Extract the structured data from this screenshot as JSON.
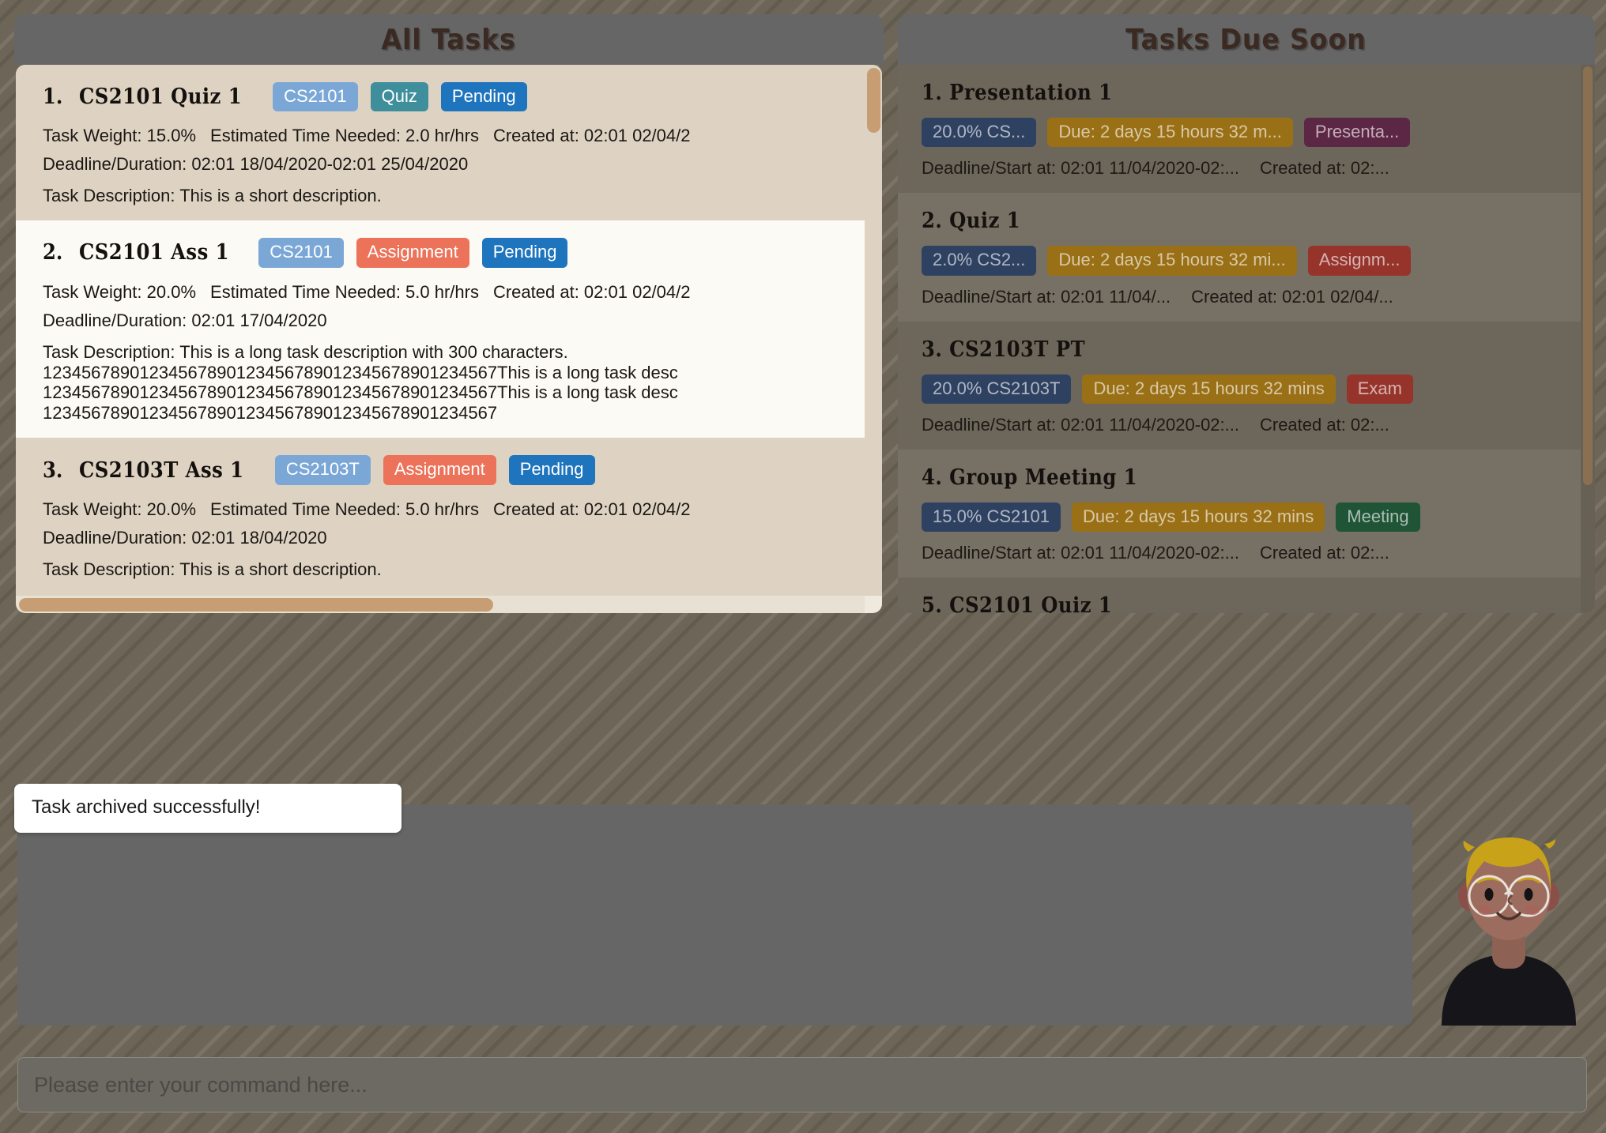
{
  "all_tasks": {
    "title": "All Tasks",
    "tasks": [
      {
        "index": "1.",
        "name": "CS2101 Quiz 1",
        "badges": [
          {
            "label": "CS2101",
            "color": "#7ba7d7"
          },
          {
            "label": "Quiz",
            "color": "#3f8e9b"
          },
          {
            "label": "Pending",
            "color": "#1f75bd"
          }
        ],
        "weight": "Task Weight: 15.0%",
        "est_time": "Estimated Time Needed: 2.0 hr/hrs",
        "created": "Created at: 02:01 02/04/2",
        "deadline": "Deadline/Duration: 02:01 18/04/2020-02:01 25/04/2020",
        "description": "Task Description: This is a short description."
      },
      {
        "index": "2.",
        "name": "CS2101 Ass 1",
        "badges": [
          {
            "label": "CS2101",
            "color": "#7ba7d7"
          },
          {
            "label": "Assignment",
            "color": "#ec7259"
          },
          {
            "label": "Pending",
            "color": "#1f75bd"
          }
        ],
        "weight": "Task Weight: 20.0%",
        "est_time": "Estimated Time Needed: 5.0 hr/hrs",
        "created": "Created at: 02:01 02/04/2",
        "deadline": "Deadline/Duration: 02:01 17/04/2020",
        "description": "Task Description: This is a long task description with 300 characters.\n12345678901234567890123456789012345678901234567This is a long task desc\n12345678901234567890123456789012345678901234567This is a long task desc\n12345678901234567890123456789012345678901234567"
      },
      {
        "index": "3.",
        "name": "CS2103T Ass 1",
        "badges": [
          {
            "label": "CS2103T",
            "color": "#7ba7d7"
          },
          {
            "label": "Assignment",
            "color": "#ec7259"
          },
          {
            "label": "Pending",
            "color": "#1f75bd"
          }
        ],
        "weight": "Task Weight: 20.0%",
        "est_time": "Estimated Time Needed: 5.0 hr/hrs",
        "created": "Created at: 02:01 02/04/2",
        "deadline": "Deadline/Duration: 02:01 18/04/2020",
        "description": "Task Description: This is a short description."
      }
    ]
  },
  "due_soon": {
    "title": "Tasks Due Soon",
    "tasks": [
      {
        "index": "1.",
        "name": "Presentation 1",
        "badges": [
          {
            "label": "20.0% CS...",
            "color": "#2e4161"
          },
          {
            "label": "Due: 2 days 15 hours 32 m...",
            "color": "#9a7016"
          },
          {
            "label": "Presenta...",
            "color": "#5c2745"
          }
        ],
        "deadline": "Deadline/Start at: 02:01 11/04/2020-02:...",
        "created": "Created at: 02:..."
      },
      {
        "index": "2.",
        "name": "Quiz 1",
        "badges": [
          {
            "label": "2.0% CS2...",
            "color": "#2e4161"
          },
          {
            "label": "Due: 2 days 15 hours 32 mi...",
            "color": "#9a7016"
          },
          {
            "label": "Assignm...",
            "color": "#96342c"
          }
        ],
        "deadline": "Deadline/Start at: 02:01 11/04/...",
        "created": "Created at: 02:01 02/04/..."
      },
      {
        "index": "3.",
        "name": "CS2103T PT",
        "badges": [
          {
            "label": "20.0% CS2103T",
            "color": "#2e4161"
          },
          {
            "label": "Due: 2 days 15 hours 32 mins",
            "color": "#9a7016"
          },
          {
            "label": "Exam",
            "color": "#96342c"
          }
        ],
        "deadline": "Deadline/Start at: 02:01 11/04/2020-02:...",
        "created": "Created at: 02:..."
      },
      {
        "index": "4.",
        "name": "Group Meeting 1",
        "badges": [
          {
            "label": "15.0% CS2101",
            "color": "#2e4161"
          },
          {
            "label": "Due: 2 days 15 hours 32 mins",
            "color": "#9a7016"
          },
          {
            "label": "Meeting",
            "color": "#1f5436"
          }
        ],
        "deadline": "Deadline/Start at: 02:01 11/04/2020-02:...",
        "created": "Created at: 02:..."
      },
      {
        "index": "5.",
        "name": "CS2101 Quiz 1",
        "badges": [],
        "deadline": "",
        "created": ""
      }
    ]
  },
  "feedback": {
    "toast_message": "Task archived successfully!",
    "response_text": ""
  },
  "command_bar": {
    "placeholder": "Please enter your command here...",
    "value": ""
  },
  "avatar": {
    "hair_color": "#c8a219",
    "skin_color": "#9c6d5f",
    "shirt_color": "#16161a",
    "glasses_color": "#e8e2db"
  },
  "theme": {
    "background": "#6d6658",
    "panel_header": "#666666",
    "left_list_odd": "#ded3c3",
    "left_list_even": "#fbfaf5",
    "right_list_odd": "#6d675b",
    "right_list_even": "#767065",
    "scrollbar_thumb": "#c79e74",
    "title_color": "#3a2a22"
  }
}
